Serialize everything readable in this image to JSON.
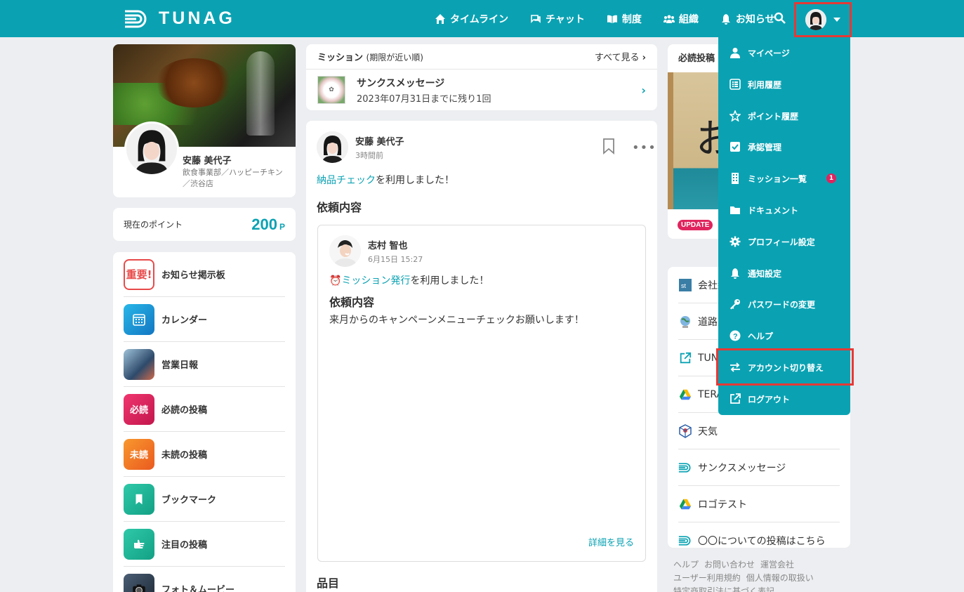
{
  "header": {
    "logo_text": "TUNAG",
    "nav": [
      {
        "label": "タイムライン",
        "icon": "home-icon"
      },
      {
        "label": "チャット",
        "icon": "chat-icon"
      },
      {
        "label": "制度",
        "icon": "book-icon"
      },
      {
        "label": "組織",
        "icon": "people-icon"
      },
      {
        "label": "お知らせ",
        "icon": "bell-icon"
      }
    ]
  },
  "profile": {
    "name": "安藤 美代子",
    "department": "飲食事業部／ハッピーチキン／渋谷店"
  },
  "points": {
    "label": "現在のポイント",
    "value": "200",
    "unit": "P"
  },
  "menu": [
    {
      "label": "お知らせ掲示板",
      "icon_text": "重要!",
      "color": "#e84a4a"
    },
    {
      "label": "カレンダー",
      "icon_text": "",
      "color": "#1b96d6"
    },
    {
      "label": "営業日報",
      "icon_text": "",
      "color": "#5b7fa3"
    },
    {
      "label": "必読の投稿",
      "icon_text": "必読",
      "color": "#e0245e"
    },
    {
      "label": "未読の投稿",
      "icon_text": "未読",
      "color": "#f07b24"
    },
    {
      "label": "ブックマーク",
      "icon_text": "",
      "color": "#1bb59a"
    },
    {
      "label": "注目の投稿",
      "icon_text": "",
      "color": "#1bb59a"
    },
    {
      "label": "フォト＆ムービー",
      "icon_text": "",
      "color": "#2a3b4f"
    }
  ],
  "mission": {
    "title": "ミッション",
    "subtitle": "(期限が近い順)",
    "see_all": "すべて見る",
    "item_title": "サンクスメッセージ",
    "item_sub": "2023年07月31日までに残り1回"
  },
  "post": {
    "author": "安藤 美代子",
    "time": "3時間前",
    "link_text": "納品チェック",
    "text_suffix": "を利用しました！",
    "heading": "依頼内容",
    "inner": {
      "author": "志村 智也",
      "time": "6月15日 15:27",
      "emoji": "⏰",
      "link_text": "ミッション発行",
      "text_suffix": "を利用しました！",
      "heading": "依頼内容",
      "body": "来月からのキャンペーンメニューチェックお願いします！",
      "more": "詳細を見る"
    },
    "heading2": "品目"
  },
  "must_read": {
    "title": "必読投稿",
    "badge": "UPDATE"
  },
  "links": [
    {
      "label": "会社紹介",
      "icon": "company-icon"
    },
    {
      "label": "道路交通情報",
      "icon": "globe-icon"
    },
    {
      "label": "TUNAG",
      "icon": "external-link-icon"
    },
    {
      "label": "TERAS",
      "icon": "drive-icon"
    },
    {
      "label": "天気",
      "icon": "weather-icon"
    },
    {
      "label": "サンクスメッセージ",
      "icon": "tunag-icon"
    },
    {
      "label": "ロゴテスト",
      "icon": "drive-icon"
    },
    {
      "label": "〇〇についての投稿はこちら",
      "icon": "tunag-icon"
    }
  ],
  "footer": {
    "line1": [
      "ヘルプ",
      "お問い合わせ",
      "運営会社"
    ],
    "line2": [
      "ユーザー利用規約",
      "個人情報の取扱い"
    ],
    "line3": [
      "特定商取引法に基づく表記"
    ]
  },
  "dropdown": [
    {
      "label": "マイページ",
      "icon": "user-icon"
    },
    {
      "label": "利用履歴",
      "icon": "list-icon"
    },
    {
      "label": "ポイント履歴",
      "icon": "star-icon"
    },
    {
      "label": "承認管理",
      "icon": "check-square-icon"
    },
    {
      "label": "ミッション一覧",
      "icon": "building-icon",
      "badge": "1"
    },
    {
      "label": "ドキュメント",
      "icon": "folder-icon"
    },
    {
      "label": "プロフィール設定",
      "icon": "gear-icon"
    },
    {
      "label": "通知設定",
      "icon": "bell-icon"
    },
    {
      "label": "パスワードの変更",
      "icon": "key-icon"
    },
    {
      "label": "ヘルプ",
      "icon": "help-icon"
    },
    {
      "label": "アカウント切り替え",
      "icon": "switch-icon"
    },
    {
      "label": "ログアウト",
      "icon": "external-link-icon"
    }
  ]
}
